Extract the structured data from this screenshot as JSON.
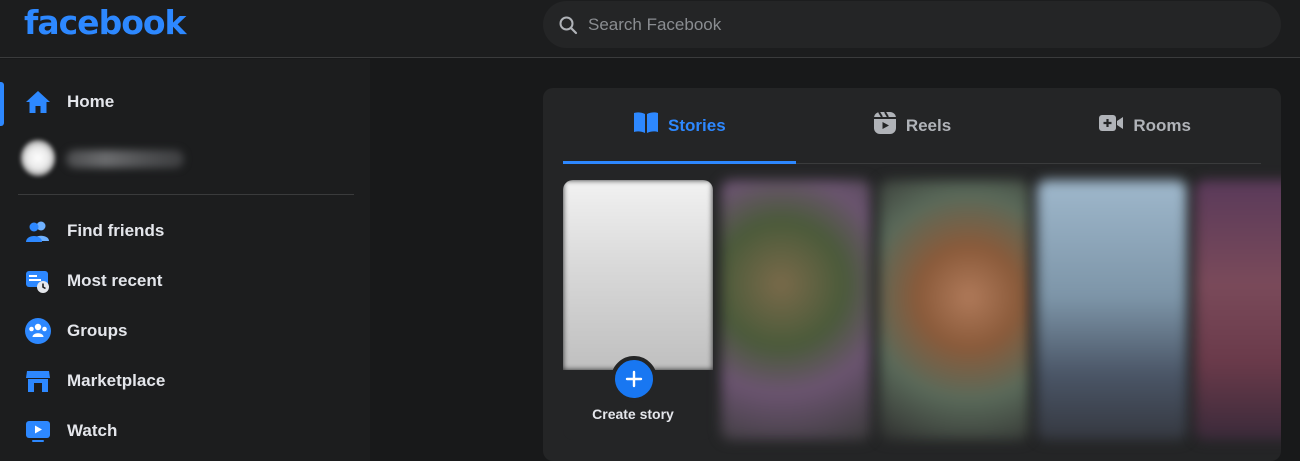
{
  "app": {
    "logo_text": "facebook",
    "brand_color": "#2d88ff"
  },
  "search": {
    "placeholder": "Search Facebook",
    "value": ""
  },
  "sidebar": {
    "items": [
      {
        "label": "Home",
        "icon": "home-icon",
        "active": true
      },
      {
        "label": "Find friends",
        "icon": "friends-icon"
      },
      {
        "label": "Most recent",
        "icon": "most-recent-icon"
      },
      {
        "label": "Groups",
        "icon": "groups-icon"
      },
      {
        "label": "Marketplace",
        "icon": "marketplace-icon"
      },
      {
        "label": "Watch",
        "icon": "watch-icon"
      }
    ]
  },
  "tabs": [
    {
      "label": "Stories",
      "icon": "stories-icon",
      "active": true
    },
    {
      "label": "Reels",
      "icon": "reels-icon"
    },
    {
      "label": "Rooms",
      "icon": "rooms-icon"
    }
  ],
  "stories": {
    "create_label": "Create story"
  }
}
